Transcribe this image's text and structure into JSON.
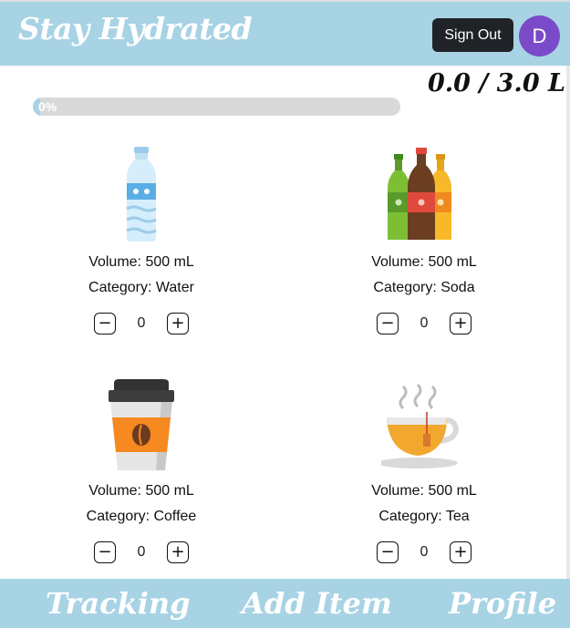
{
  "header": {
    "title": "Stay Hydrated",
    "sign_out_label": "Sign Out",
    "avatar_initial": "D"
  },
  "summary": {
    "total": "0.0 / 3.0 L",
    "progress_label": "0%",
    "progress_fraction": 0
  },
  "items": [
    {
      "volume": "Volume: 500 mL",
      "category": "Category: Water",
      "count": "0",
      "icon": "water-bottle-icon"
    },
    {
      "volume": "Volume: 500 mL",
      "category": "Category: Soda",
      "count": "0",
      "icon": "soda-bottles-icon"
    },
    {
      "volume": "Volume: 500 mL",
      "category": "Category: Coffee",
      "count": "0",
      "icon": "coffee-cup-icon"
    },
    {
      "volume": "Volume: 500 mL",
      "category": "Category: Tea",
      "count": "0",
      "icon": "tea-cup-icon"
    }
  ],
  "stepper": {
    "minus": "−",
    "plus": "+"
  },
  "nav": {
    "tracking": "Tracking",
    "add_item": "Add Item",
    "profile": "Profile"
  },
  "colors": {
    "header_bg": "#a7d3e4",
    "sign_out_bg": "#1f2328",
    "avatar_bg": "#7b4ac8"
  }
}
